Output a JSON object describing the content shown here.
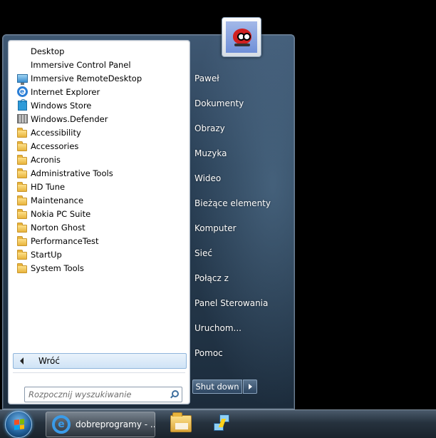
{
  "start_menu": {
    "programs": [
      {
        "label": "Desktop",
        "icon": "none"
      },
      {
        "label": "Immersive Control Panel",
        "icon": "none"
      },
      {
        "label": "Immersive RemoteDesktop",
        "icon": "remote-desktop-icon"
      },
      {
        "label": "Internet Explorer",
        "icon": "internet-explorer-icon"
      },
      {
        "label": "Windows Store",
        "icon": "windows-store-icon"
      },
      {
        "label": "Windows.Defender",
        "icon": "windows-defender-icon"
      },
      {
        "label": "Accessibility",
        "icon": "folder-icon"
      },
      {
        "label": "Accessories",
        "icon": "folder-icon"
      },
      {
        "label": "Acronis",
        "icon": "folder-icon"
      },
      {
        "label": "Administrative Tools",
        "icon": "folder-icon"
      },
      {
        "label": "HD Tune",
        "icon": "folder-icon"
      },
      {
        "label": "Maintenance",
        "icon": "folder-icon"
      },
      {
        "label": "Nokia PC Suite",
        "icon": "folder-icon"
      },
      {
        "label": "Norton Ghost",
        "icon": "folder-icon"
      },
      {
        "label": "PerformanceTest",
        "icon": "folder-icon"
      },
      {
        "label": "StartUp",
        "icon": "folder-icon"
      },
      {
        "label": "System Tools",
        "icon": "folder-icon"
      }
    ],
    "back_label": "Wróć",
    "search_placeholder": "Rozpocznij wyszukiwanie",
    "right_links": [
      "Paweł",
      "Dokumenty",
      "Obrazy",
      "Muzyka",
      "Wideo",
      "Bieżące elementy",
      "Komputer",
      "Sieć",
      "Połącz z",
      "Panel Sterowania",
      "Uruchom...",
      "Pomoc"
    ],
    "shutdown_label": "Shut down"
  },
  "taskbar": {
    "active_item_label": "dobreprogramy - ..."
  },
  "colors": {
    "menu_bg": "#2a4056",
    "left_pane_bg": "#ffffff",
    "taskbar_bg": "#26323e",
    "folder_yellow": "#e8b43c",
    "ie_blue": "#2a7ed6"
  }
}
